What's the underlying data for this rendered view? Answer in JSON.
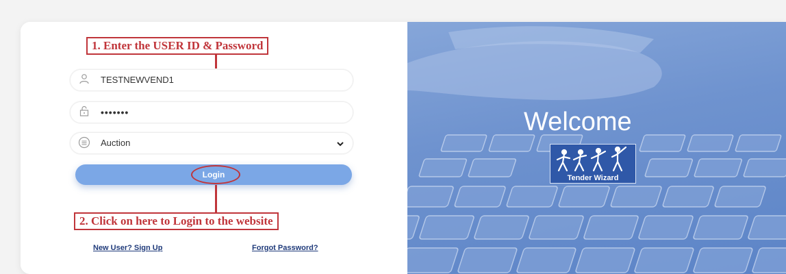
{
  "login": {
    "user_id_value": "TESTNEWVEND1",
    "password_value": "•••••••",
    "role_select_value": "Auction",
    "login_button_label": "Login",
    "new_user_link": "New User? Sign Up",
    "forgot_password_link": "Forgot Password?"
  },
  "annotations": {
    "step1": "1. Enter the USER ID & Password",
    "step2": "2. Click on here to Login to the website"
  },
  "banner": {
    "welcome_text": "Welcome",
    "logo_text": "Tender Wizard"
  },
  "colors": {
    "annotation": "#c0353a",
    "login_button": "#7ba7e6",
    "link": "#1f3a7a",
    "banner": "#6f93cf"
  },
  "icons": [
    "user-icon",
    "lock-icon",
    "list-icon",
    "chevron-down-icon"
  ]
}
